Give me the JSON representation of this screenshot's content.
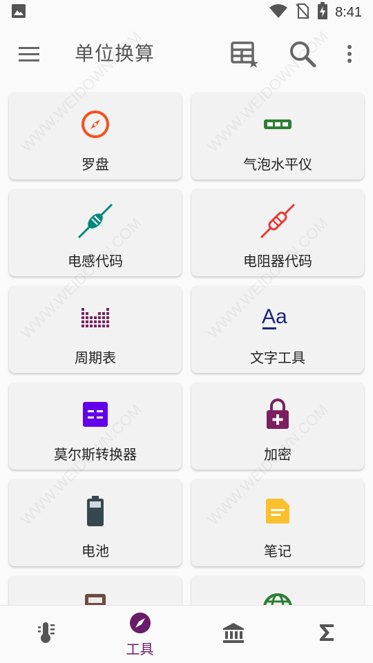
{
  "status_bar": {
    "time": "8:41",
    "icons": [
      "image-icon",
      "wifi-icon",
      "no-sim-icon",
      "battery-charging-icon"
    ]
  },
  "toolbar": {
    "title": "单位换算",
    "icons": [
      "menu-icon",
      "favorites-grid-icon",
      "search-icon",
      "more-vert-icon"
    ]
  },
  "tools": [
    {
      "label": "罗盘",
      "icon": "compass-icon",
      "color": "#f4511e"
    },
    {
      "label": "气泡水平仪",
      "icon": "bubble-level-icon",
      "color": "#2e7d32"
    },
    {
      "label": "电感代码",
      "icon": "inductor-icon",
      "color": "#00897b"
    },
    {
      "label": "电阻器代码",
      "icon": "resistor-icon",
      "color": "#e53935"
    },
    {
      "label": "周期表",
      "icon": "periodic-table-icon",
      "color": "#7b1f5e"
    },
    {
      "label": "文字工具",
      "icon": "text-tools-icon",
      "color": "#1a237e"
    },
    {
      "label": "莫尔斯转换器",
      "icon": "morse-icon",
      "color": "#6200ea"
    },
    {
      "label": "加密",
      "icon": "encryption-lock-icon",
      "color": "#7b1f5e"
    },
    {
      "label": "电池",
      "icon": "battery-icon",
      "color": "#37474f"
    },
    {
      "label": "笔记",
      "icon": "notes-icon",
      "color": "#fbc02d"
    },
    {
      "label": "",
      "icon": "calculator-icon",
      "color": "#6d4c41"
    },
    {
      "label": "",
      "icon": "globe-icon",
      "color": "#2e7d32"
    }
  ],
  "bottom_nav": {
    "items": [
      {
        "name": "converters",
        "icon": "thermometer-icon",
        "label": "",
        "active": false
      },
      {
        "name": "tools",
        "icon": "compass-nav-icon",
        "label": "工具",
        "active": true
      },
      {
        "name": "finance",
        "icon": "bank-icon",
        "label": "",
        "active": false
      },
      {
        "name": "math",
        "icon": "sigma-icon",
        "label": "",
        "active": false
      }
    ],
    "active_color": "#6a1b6a"
  },
  "watermark": "WWW.WEIDOWN.COM"
}
